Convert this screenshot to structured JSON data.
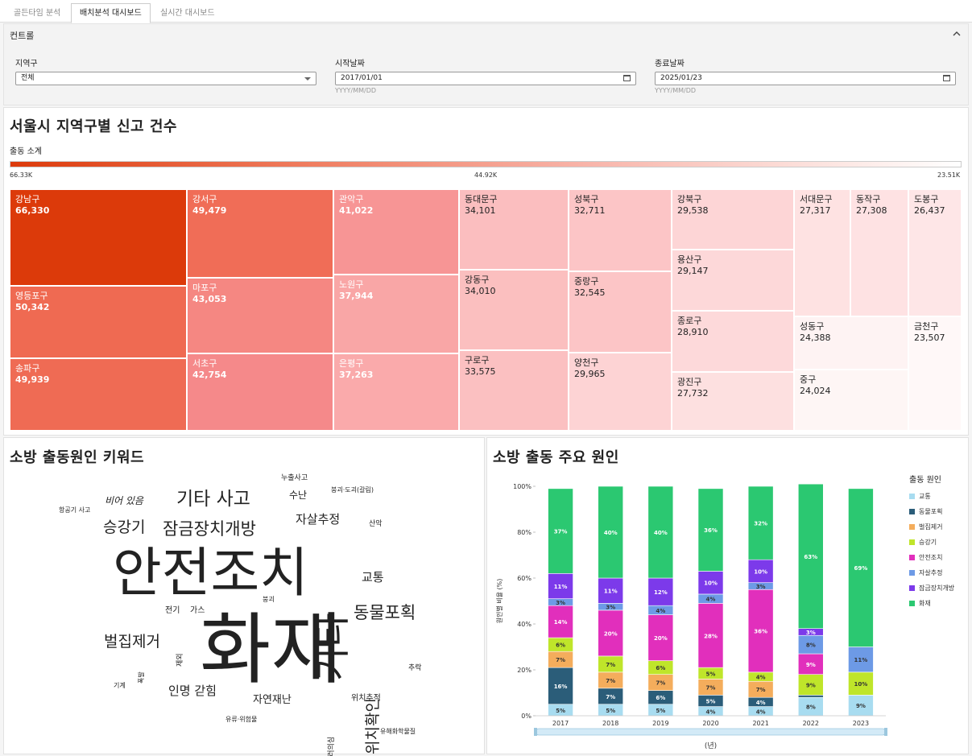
{
  "tabs": [
    "골든타임 분석",
    "배치분석 대시보드",
    "실시간 대시보드"
  ],
  "active_tab": 1,
  "controls": {
    "title": "컨트롤",
    "district_label": "지역구",
    "district_value": "전체",
    "start_label": "시작날짜",
    "start_value": "2017/01/01",
    "start_hint": "YYYY/MM/DD",
    "end_label": "종료날짜",
    "end_value": "2025/01/23",
    "end_hint": "YYYY/MM/DD"
  },
  "treemap": {
    "title": "서울시 지역구별 신고 건수",
    "legend_label": "출동 소계",
    "scale_max": "66.33K",
    "scale_mid": "44.92K",
    "scale_min": "23.51K",
    "cells": [
      {
        "name": "강남구",
        "value": "66,330",
        "color": "#dc3a0a"
      },
      {
        "name": "영등포구",
        "value": "50,342",
        "color": "#ef6a52"
      },
      {
        "name": "송파구",
        "value": "49,939",
        "color": "#ef6b54"
      },
      {
        "name": "강서구",
        "value": "49,479",
        "color": "#f06d57"
      },
      {
        "name": "마포구",
        "value": "43,053",
        "color": "#f58782"
      },
      {
        "name": "서초구",
        "value": "42,754",
        "color": "#f5898a"
      },
      {
        "name": "관악구",
        "value": "41,022",
        "color": "#f79595"
      },
      {
        "name": "노원구",
        "value": "37,944",
        "color": "#f9a6a6"
      },
      {
        "name": "은평구",
        "value": "37,263",
        "color": "#faaaab"
      },
      {
        "name": "동대문구",
        "value": "34,101",
        "color": "#fbbebf"
      },
      {
        "name": "강동구",
        "value": "34,010",
        "color": "#fbbfbf"
      },
      {
        "name": "구로구",
        "value": "33,575",
        "color": "#fbc0c1"
      },
      {
        "name": "성북구",
        "value": "32,711",
        "color": "#fcc5c6"
      },
      {
        "name": "중랑구",
        "value": "32,545",
        "color": "#fcc5c6"
      },
      {
        "name": "양천구",
        "value": "29,965",
        "color": "#fdd3d4"
      },
      {
        "name": "강북구",
        "value": "29,538",
        "color": "#fdd5d6"
      },
      {
        "name": "용산구",
        "value": "29,147",
        "color": "#fdd8d9"
      },
      {
        "name": "종로구",
        "value": "28,910",
        "color": "#fdd9da"
      },
      {
        "name": "광진구",
        "value": "27,732",
        "color": "#fde0e0"
      },
      {
        "name": "서대문구",
        "value": "27,317",
        "color": "#fee2e2"
      },
      {
        "name": "동작구",
        "value": "27,308",
        "color": "#fee2e3"
      },
      {
        "name": "도봉구",
        "value": "26,437",
        "color": "#fee6e7"
      },
      {
        "name": "성동구",
        "value": "24,388",
        "color": "#fef3f3"
      },
      {
        "name": "금천구",
        "value": "23,507",
        "color": "#fff8f8"
      },
      {
        "name": "중구",
        "value": "24,024",
        "color": "#fef6f5"
      }
    ]
  },
  "wordcloud": {
    "title": "소방 출동원인 키워드",
    "words": [
      "안전조치",
      "화재",
      "기타",
      "기타 사고",
      "잠금장치개방",
      "승강기",
      "벌집제거",
      "동물포획",
      "위치확인",
      "자살추정",
      "교통",
      "인명 갇힘",
      "자연재난",
      "비어 있음",
      "수난",
      "누출사고",
      "붕괴·도괴(갈림)",
      "항공기 사고",
      "산악",
      "전기",
      "가스",
      "붕괴",
      "기계",
      "추락",
      "위치추적",
      "유류·위험물",
      "유해화학물질",
      "폭발",
      "제외",
      "테러의심"
    ]
  },
  "bar_chart": {
    "title": "소방 출동 주요 원인",
    "legend_title": "출동 원인",
    "x_axis_title": "(년)",
    "y_axis_title": "원인별 비율 (%)",
    "y_ticks": [
      "0%",
      "20%",
      "40%",
      "60%",
      "80%",
      "100%"
    ]
  },
  "chart_data": {
    "type": "bar",
    "stacked": true,
    "title": "소방 출동 주요 원인",
    "xlabel": "(년)",
    "ylabel": "원인별 비율 (%)",
    "ylim": [
      0,
      100
    ],
    "categories": [
      "2017",
      "2018",
      "2019",
      "2020",
      "2021",
      "2022",
      "2023"
    ],
    "series": [
      {
        "name": "교통",
        "color": "#a8dcf0",
        "values": [
          5,
          5,
          5,
          4,
          4,
          8,
          9
        ],
        "labels": [
          "5%",
          "5%",
          "5%",
          "4%",
          "4%",
          "8%",
          "9%"
        ]
      },
      {
        "name": "동물포획",
        "color": "#2b5d79",
        "values": [
          16,
          7,
          6,
          5,
          4,
          1,
          0
        ],
        "labels": [
          "16%",
          "7%",
          "6%",
          "5%",
          "4%",
          "1%",
          ""
        ]
      },
      {
        "name": "벌집제거",
        "color": "#f4ad5c",
        "values": [
          7,
          7,
          7,
          7,
          7,
          0,
          0
        ],
        "labels": [
          "7%",
          "7%",
          "7%",
          "7%",
          "7%",
          "",
          ""
        ]
      },
      {
        "name": "승강기",
        "color": "#bfe52a",
        "values": [
          6,
          7,
          6,
          5,
          4,
          9,
          10
        ],
        "labels": [
          "6%",
          "7%",
          "6%",
          "5%",
          "4%",
          "9%",
          "10%"
        ]
      },
      {
        "name": "안전조치",
        "color": "#e12fbc",
        "values": [
          14,
          20,
          20,
          28,
          36,
          9,
          0
        ],
        "labels": [
          "14%",
          "20%",
          "20%",
          "28%",
          "36%",
          "9%",
          ""
        ]
      },
      {
        "name": "자살추정",
        "color": "#6d9ae6",
        "values": [
          3,
          3,
          4,
          4,
          3,
          8,
          11
        ],
        "labels": [
          "3%",
          "3%",
          "4%",
          "4%",
          "3%",
          "8%",
          "11%"
        ]
      },
      {
        "name": "잠금장치개방",
        "color": "#7c3aea",
        "values": [
          11,
          11,
          12,
          10,
          10,
          3,
          0
        ],
        "labels": [
          "11%",
          "11%",
          "12%",
          "10%",
          "10%",
          "3%",
          ""
        ]
      },
      {
        "name": "화재",
        "color": "#2bc871",
        "values": [
          37,
          40,
          40,
          36,
          32,
          63,
          69
        ],
        "labels": [
          "37%",
          "40%",
          "40%",
          "36%",
          "32%",
          "63%",
          "69%"
        ]
      }
    ]
  }
}
